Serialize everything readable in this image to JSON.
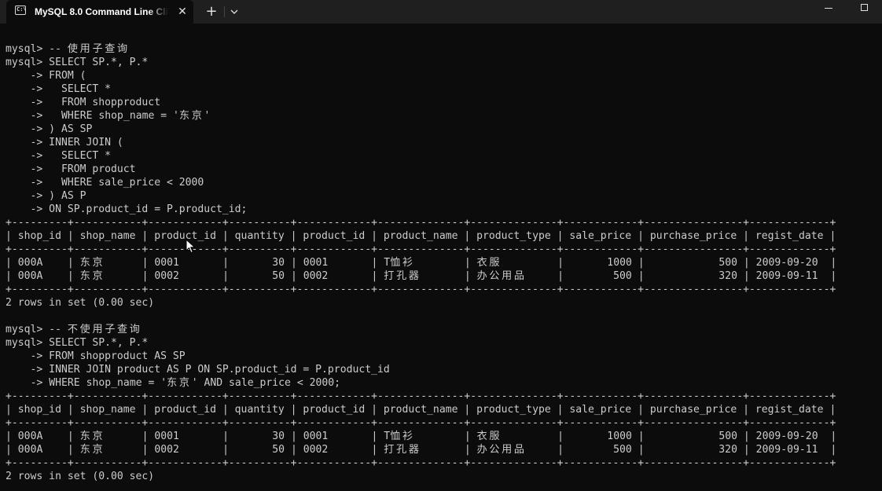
{
  "window": {
    "tab_title": "MySQL 8.0 Command Line Cli",
    "tab_icon": "console-icon",
    "close_glyph": "✕",
    "new_tab_glyph": "+",
    "colors": {
      "background": "#0c0c0c",
      "titlebar": "#1f1f1f",
      "text": "#cccccc"
    }
  },
  "terminal": {
    "lines": [
      "mysql> -- 使用子查询",
      "mysql> SELECT SP.*, P.*",
      "    -> FROM (",
      "    ->   SELECT *",
      "    ->   FROM shopproduct",
      "    ->   WHERE shop_name = '东京'",
      "    -> ) AS SP",
      "    -> INNER JOIN (",
      "    ->   SELECT *",
      "    ->   FROM product",
      "    ->   WHERE sale_price < 2000",
      "    -> ) AS P",
      "    -> ON SP.product_id = P.product_id;",
      "+---------+-----------+------------+----------+------------+--------------+--------------+------------+----------------+-------------+",
      "| shop_id | shop_name | product_id | quantity | product_id | product_name | product_type | sale_price | purchase_price | regist_date |",
      "+---------+-----------+------------+----------+------------+--------------+--------------+------------+----------------+-------------+",
      "| 000A    | 东京      | 0001       |       30 | 0001       | T恤衫        | 衣服         |       1000 |            500 | 2009-09-20  |",
      "| 000A    | 东京      | 0002       |       50 | 0002       | 打孔器       | 办公用品     |        500 |            320 | 2009-09-11  |",
      "+---------+-----------+------------+----------+------------+--------------+--------------+------------+----------------+-------------+",
      "2 rows in set (0.00 sec)",
      "",
      "mysql> -- 不使用子查询",
      "mysql> SELECT SP.*, P.*",
      "    -> FROM shopproduct AS SP",
      "    -> INNER JOIN product AS P ON SP.product_id = P.product_id",
      "    -> WHERE shop_name = '东京' AND sale_price < 2000;",
      "+---------+-----------+------------+----------+------------+--------------+--------------+------------+----------------+-------------+",
      "| shop_id | shop_name | product_id | quantity | product_id | product_name | product_type | sale_price | purchase_price | regist_date |",
      "+---------+-----------+------------+----------+------------+--------------+--------------+------------+----------------+-------------+",
      "| 000A    | 东京      | 0001       |       30 | 0001       | T恤衫        | 衣服         |       1000 |            500 | 2009-09-20  |",
      "| 000A    | 东京      | 0002       |       50 | 0002       | 打孔器       | 办公用品     |        500 |            320 | 2009-09-11  |",
      "+---------+-----------+------------+----------+------------+--------------+--------------+------------+----------------+-------------+",
      "2 rows in set (0.00 sec)"
    ]
  }
}
